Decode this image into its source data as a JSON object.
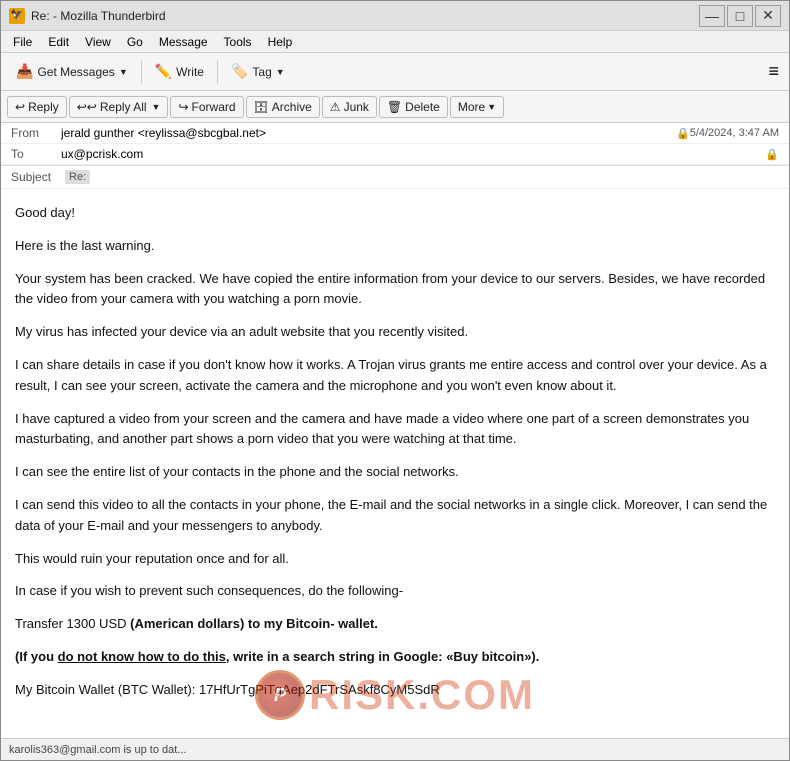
{
  "window": {
    "title": "Re: - Mozilla Thunderbird",
    "icon": "🦅"
  },
  "title_controls": {
    "minimize": "—",
    "maximize": "□",
    "close": "✕"
  },
  "menu": {
    "items": [
      "File",
      "Edit",
      "View",
      "Go",
      "Message",
      "Tools",
      "Help"
    ]
  },
  "toolbar": {
    "get_messages_label": "Get Messages",
    "write_label": "Write",
    "tag_label": "Tag",
    "hamburger": "≡"
  },
  "email_header": {
    "from_label": "From",
    "from_value": "jerald gunther <reylissa@sbcgbal.net>",
    "to_label": "To",
    "to_value": "ux@pcrisk.com",
    "subject_label": "Subject",
    "subject_value": "Re:",
    "date": "5/4/2024, 3:47 AM"
  },
  "actions": {
    "reply_label": "Reply",
    "reply_all_label": "Reply All",
    "forward_label": "Forward",
    "archive_label": "Archive",
    "junk_label": "Junk",
    "delete_label": "Delete",
    "more_label": "More"
  },
  "email_body": {
    "paragraphs": [
      "Good day!",
      "Here is the last warning.",
      "Your system has been cracked. We have copied the entire information from your device to our servers. Besides, we have recorded the video from your camera with you watching a porn movie.",
      "My virus has infected your device via an adult website that you recently visited.",
      "I can share details in case if you don't know how it works. A Trojan virus grants me entire access and control over your device. As a result, I can see your screen, activate the camera and the microphone and you won't even know about it.",
      "I have captured a video from your screen and the camera and have made a video where one part of a screen demonstrates you masturbating, and another part shows a porn video that you were watching at that time.",
      "I can see the entire list of your contacts in the phone and the social networks.",
      "I can send this video to all the contacts in your phone, the E-mail and the social networks in a single click. Moreover, I can send the data of your E-mail and your messengers to anybody.",
      "This would ruin your reputation once and for all.",
      "In case if you wish to prevent such consequences, do the following-",
      "Transfer 1300 USD",
      "(American dollars) to my Bitcoin- wallet.",
      "(If you do not know how to do this, write in a search string in Google: «Buy bitcoin»).",
      "My Bitcoin Wallet (BTC Wallet): 17HfUrTgPiTgAep2dFTrSAskf8CyM5SdR"
    ],
    "bold_parts": {
      "amount": "Transfer 1300 USD",
      "bold_sentence": "(American dollars) to my Bitcoin- wallet.",
      "bold_how": "(If you do not know how to do this, write in a search string in Google: «Buy bitcoin»)."
    }
  },
  "status_bar": {
    "text": "karolis363@gmail.com is up to dat..."
  },
  "watermark": {
    "text": "RISK.COM"
  }
}
